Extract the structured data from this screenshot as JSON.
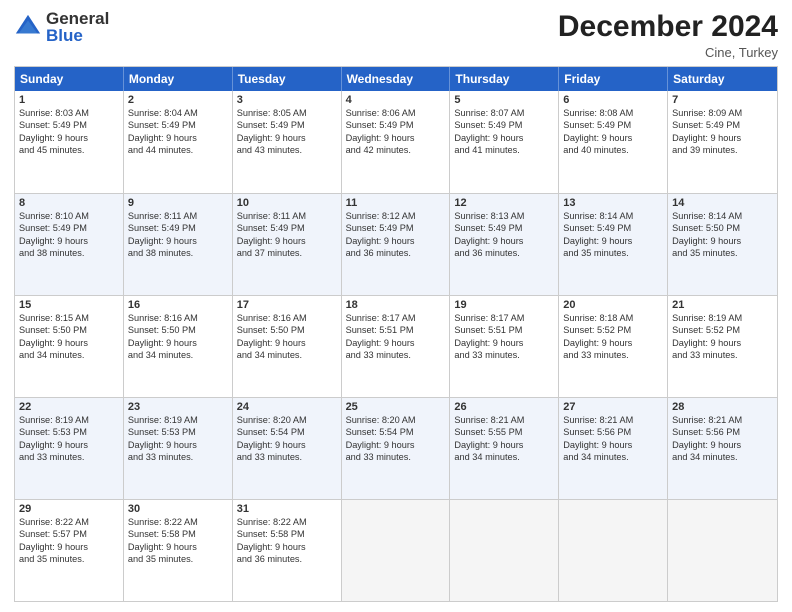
{
  "header": {
    "logo_general": "General",
    "logo_blue": "Blue",
    "month_title": "December 2024",
    "location": "Cine, Turkey"
  },
  "days_of_week": [
    "Sunday",
    "Monday",
    "Tuesday",
    "Wednesday",
    "Thursday",
    "Friday",
    "Saturday"
  ],
  "weeks": [
    {
      "alt": false,
      "cells": [
        {
          "day": "1",
          "lines": [
            "Sunrise: 8:03 AM",
            "Sunset: 5:49 PM",
            "Daylight: 9 hours",
            "and 45 minutes."
          ]
        },
        {
          "day": "2",
          "lines": [
            "Sunrise: 8:04 AM",
            "Sunset: 5:49 PM",
            "Daylight: 9 hours",
            "and 44 minutes."
          ]
        },
        {
          "day": "3",
          "lines": [
            "Sunrise: 8:05 AM",
            "Sunset: 5:49 PM",
            "Daylight: 9 hours",
            "and 43 minutes."
          ]
        },
        {
          "day": "4",
          "lines": [
            "Sunrise: 8:06 AM",
            "Sunset: 5:49 PM",
            "Daylight: 9 hours",
            "and 42 minutes."
          ]
        },
        {
          "day": "5",
          "lines": [
            "Sunrise: 8:07 AM",
            "Sunset: 5:49 PM",
            "Daylight: 9 hours",
            "and 41 minutes."
          ]
        },
        {
          "day": "6",
          "lines": [
            "Sunrise: 8:08 AM",
            "Sunset: 5:49 PM",
            "Daylight: 9 hours",
            "and 40 minutes."
          ]
        },
        {
          "day": "7",
          "lines": [
            "Sunrise: 8:09 AM",
            "Sunset: 5:49 PM",
            "Daylight: 9 hours",
            "and 39 minutes."
          ]
        }
      ]
    },
    {
      "alt": true,
      "cells": [
        {
          "day": "8",
          "lines": [
            "Sunrise: 8:10 AM",
            "Sunset: 5:49 PM",
            "Daylight: 9 hours",
            "and 38 minutes."
          ]
        },
        {
          "day": "9",
          "lines": [
            "Sunrise: 8:11 AM",
            "Sunset: 5:49 PM",
            "Daylight: 9 hours",
            "and 38 minutes."
          ]
        },
        {
          "day": "10",
          "lines": [
            "Sunrise: 8:11 AM",
            "Sunset: 5:49 PM",
            "Daylight: 9 hours",
            "and 37 minutes."
          ]
        },
        {
          "day": "11",
          "lines": [
            "Sunrise: 8:12 AM",
            "Sunset: 5:49 PM",
            "Daylight: 9 hours",
            "and 36 minutes."
          ]
        },
        {
          "day": "12",
          "lines": [
            "Sunrise: 8:13 AM",
            "Sunset: 5:49 PM",
            "Daylight: 9 hours",
            "and 36 minutes."
          ]
        },
        {
          "day": "13",
          "lines": [
            "Sunrise: 8:14 AM",
            "Sunset: 5:49 PM",
            "Daylight: 9 hours",
            "and 35 minutes."
          ]
        },
        {
          "day": "14",
          "lines": [
            "Sunrise: 8:14 AM",
            "Sunset: 5:50 PM",
            "Daylight: 9 hours",
            "and 35 minutes."
          ]
        }
      ]
    },
    {
      "alt": false,
      "cells": [
        {
          "day": "15",
          "lines": [
            "Sunrise: 8:15 AM",
            "Sunset: 5:50 PM",
            "Daylight: 9 hours",
            "and 34 minutes."
          ]
        },
        {
          "day": "16",
          "lines": [
            "Sunrise: 8:16 AM",
            "Sunset: 5:50 PM",
            "Daylight: 9 hours",
            "and 34 minutes."
          ]
        },
        {
          "day": "17",
          "lines": [
            "Sunrise: 8:16 AM",
            "Sunset: 5:50 PM",
            "Daylight: 9 hours",
            "and 34 minutes."
          ]
        },
        {
          "day": "18",
          "lines": [
            "Sunrise: 8:17 AM",
            "Sunset: 5:51 PM",
            "Daylight: 9 hours",
            "and 33 minutes."
          ]
        },
        {
          "day": "19",
          "lines": [
            "Sunrise: 8:17 AM",
            "Sunset: 5:51 PM",
            "Daylight: 9 hours",
            "and 33 minutes."
          ]
        },
        {
          "day": "20",
          "lines": [
            "Sunrise: 8:18 AM",
            "Sunset: 5:52 PM",
            "Daylight: 9 hours",
            "and 33 minutes."
          ]
        },
        {
          "day": "21",
          "lines": [
            "Sunrise: 8:19 AM",
            "Sunset: 5:52 PM",
            "Daylight: 9 hours",
            "and 33 minutes."
          ]
        }
      ]
    },
    {
      "alt": true,
      "cells": [
        {
          "day": "22",
          "lines": [
            "Sunrise: 8:19 AM",
            "Sunset: 5:53 PM",
            "Daylight: 9 hours",
            "and 33 minutes."
          ]
        },
        {
          "day": "23",
          "lines": [
            "Sunrise: 8:19 AM",
            "Sunset: 5:53 PM",
            "Daylight: 9 hours",
            "and 33 minutes."
          ]
        },
        {
          "day": "24",
          "lines": [
            "Sunrise: 8:20 AM",
            "Sunset: 5:54 PM",
            "Daylight: 9 hours",
            "and 33 minutes."
          ]
        },
        {
          "day": "25",
          "lines": [
            "Sunrise: 8:20 AM",
            "Sunset: 5:54 PM",
            "Daylight: 9 hours",
            "and 33 minutes."
          ]
        },
        {
          "day": "26",
          "lines": [
            "Sunrise: 8:21 AM",
            "Sunset: 5:55 PM",
            "Daylight: 9 hours",
            "and 34 minutes."
          ]
        },
        {
          "day": "27",
          "lines": [
            "Sunrise: 8:21 AM",
            "Sunset: 5:56 PM",
            "Daylight: 9 hours",
            "and 34 minutes."
          ]
        },
        {
          "day": "28",
          "lines": [
            "Sunrise: 8:21 AM",
            "Sunset: 5:56 PM",
            "Daylight: 9 hours",
            "and 34 minutes."
          ]
        }
      ]
    },
    {
      "alt": false,
      "cells": [
        {
          "day": "29",
          "lines": [
            "Sunrise: 8:22 AM",
            "Sunset: 5:57 PM",
            "Daylight: 9 hours",
            "and 35 minutes."
          ]
        },
        {
          "day": "30",
          "lines": [
            "Sunrise: 8:22 AM",
            "Sunset: 5:58 PM",
            "Daylight: 9 hours",
            "and 35 minutes."
          ]
        },
        {
          "day": "31",
          "lines": [
            "Sunrise: 8:22 AM",
            "Sunset: 5:58 PM",
            "Daylight: 9 hours",
            "and 36 minutes."
          ]
        },
        {
          "day": "",
          "lines": []
        },
        {
          "day": "",
          "lines": []
        },
        {
          "day": "",
          "lines": []
        },
        {
          "day": "",
          "lines": []
        }
      ]
    }
  ]
}
